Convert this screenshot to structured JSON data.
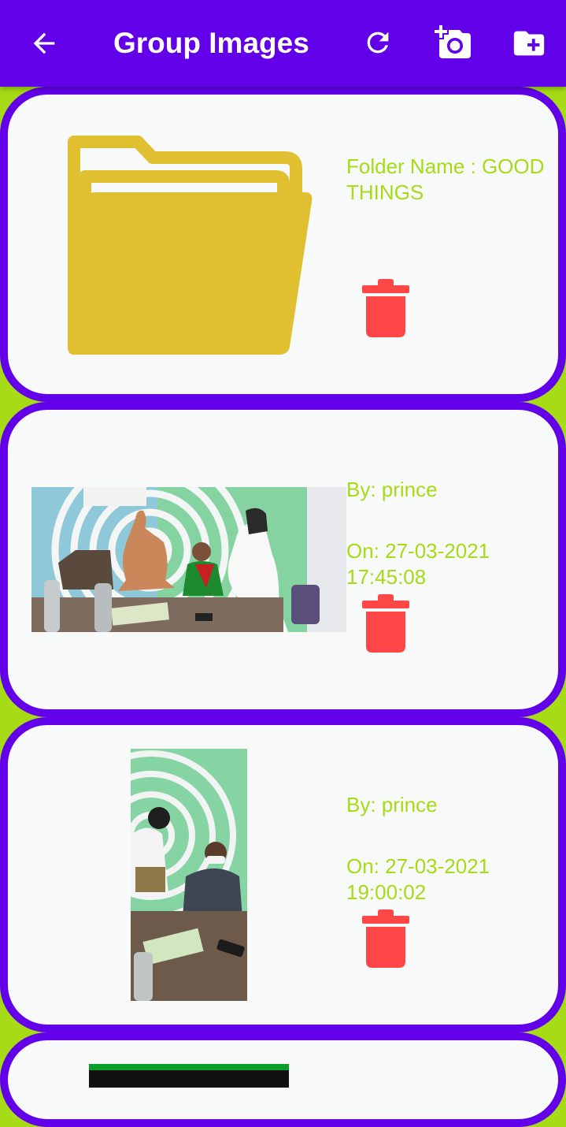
{
  "header": {
    "title": "Group Images",
    "icons": [
      "back-arrow-icon",
      "refresh-icon",
      "add-photo-camera-icon",
      "create-folder-icon"
    ]
  },
  "colors": {
    "app_bar": "#6200ea",
    "background": "#a6db16",
    "card": "#f8f9f9",
    "text": "#a6db16",
    "delete": "#ff4747",
    "folder": "#e0c030"
  },
  "items": [
    {
      "type": "folder",
      "label": "Folder Name : GOOD THINGS"
    },
    {
      "type": "image",
      "by": "By: prince",
      "on": "On: 27-03-2021 17:45:08"
    },
    {
      "type": "image",
      "by": "By: prince",
      "on": "On: 27-03-2021 19:00:02"
    },
    {
      "type": "image"
    }
  ]
}
